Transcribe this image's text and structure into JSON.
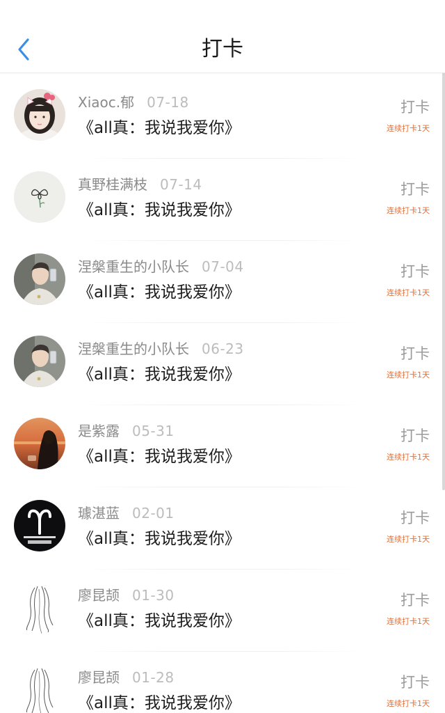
{
  "header": {
    "title": "打卡",
    "back_icon": "chevron-left-icon",
    "accent_color": "#3a8ee6"
  },
  "check_label": "打卡",
  "items": [
    {
      "name": "Xiaoc.郁",
      "date": "07-18",
      "content": "《all真：我说我爱你》",
      "streak": "连续打卡1天",
      "avatar": "girl-portrait-icon"
    },
    {
      "name": "真野桂满枝",
      "date": "07-14",
      "content": "《all真：我说我爱你》",
      "streak": "连续打卡1天",
      "avatar": "flower-sketch-icon"
    },
    {
      "name": "涅槃重生的小队长",
      "date": "07-04",
      "content": "《all真：我说我爱你》",
      "streak": "连续打卡1天",
      "avatar": "man-selfie-icon"
    },
    {
      "name": "涅槃重生的小队长",
      "date": "06-23",
      "content": "《all真：我说我爱你》",
      "streak": "连续打卡1天",
      "avatar": "man-selfie-icon"
    },
    {
      "name": "是紫露",
      "date": "05-31",
      "content": "《all真：我说我爱你》",
      "streak": "连续打卡1天",
      "avatar": "sunset-girl-icon"
    },
    {
      "name": "璩湛蓝",
      "date": "02-01",
      "content": "《all真：我说我爱你》",
      "streak": "连续打卡1天",
      "avatar": "aries-zodiac-icon"
    },
    {
      "name": "廖昆颉",
      "date": "01-30",
      "content": "《all真：我说我爱你》",
      "streak": "连续打卡1天",
      "avatar": "hair-sketch-icon"
    },
    {
      "name": "廖昆颉",
      "date": "01-28",
      "content": "《all真：我说我爱你》",
      "streak": "连续打卡1天",
      "avatar": "hair-sketch-icon"
    }
  ],
  "colors": {
    "streak": "#e0703a",
    "name": "#8a8a8a",
    "date": "#bcbcbc"
  }
}
